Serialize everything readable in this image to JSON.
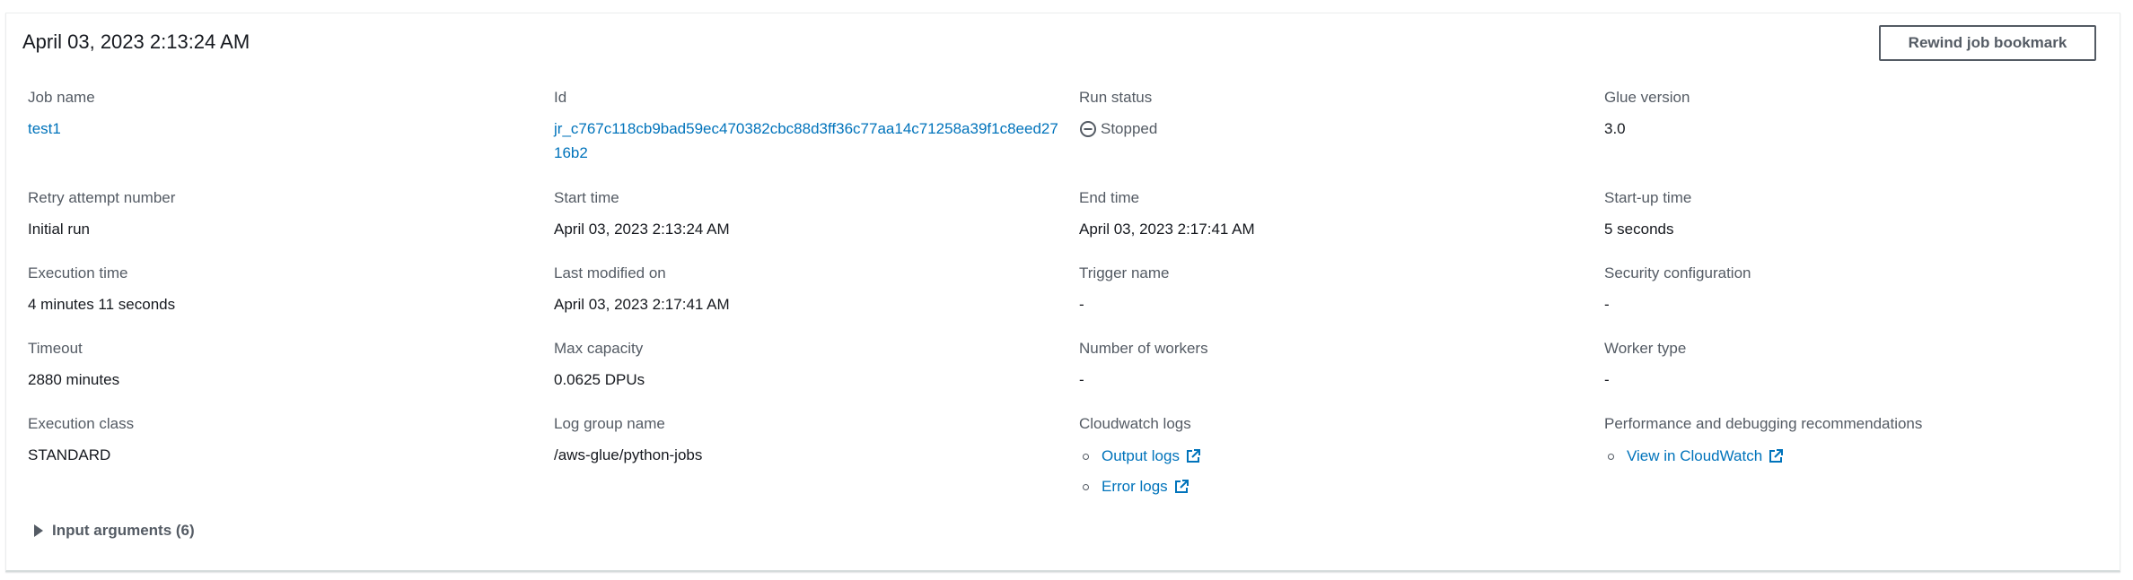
{
  "header": {
    "title": "April 03, 2023 2:13:24 AM",
    "rewind_button": "Rewind job bookmark"
  },
  "fields": {
    "job_name": {
      "label": "Job name",
      "value": "test1"
    },
    "id": {
      "label": "Id",
      "value": "jr_c767c118cb9bad59ec470382cbc88d3ff36c77aa14c71258a39f1c8eed2716b2"
    },
    "run_status": {
      "label": "Run status",
      "value": "Stopped",
      "icon": "stopped-status-icon"
    },
    "glue_version": {
      "label": "Glue version",
      "value": "3.0"
    },
    "retry_attempt": {
      "label": "Retry attempt number",
      "value": "Initial run"
    },
    "start_time": {
      "label": "Start time",
      "value": "April 03, 2023 2:13:24 AM"
    },
    "end_time": {
      "label": "End time",
      "value": "April 03, 2023 2:17:41 AM"
    },
    "startup_time": {
      "label": "Start-up time",
      "value": "5 seconds"
    },
    "execution_time": {
      "label": "Execution time",
      "value": "4 minutes 11 seconds"
    },
    "last_modified": {
      "label": "Last modified on",
      "value": "April 03, 2023 2:17:41 AM"
    },
    "trigger_name": {
      "label": "Trigger name",
      "value": "-"
    },
    "security_config": {
      "label": "Security configuration",
      "value": "-"
    },
    "timeout": {
      "label": "Timeout",
      "value": "2880 minutes"
    },
    "max_capacity": {
      "label": "Max capacity",
      "value": "0.0625 DPUs"
    },
    "num_workers": {
      "label": "Number of workers",
      "value": "-"
    },
    "worker_type": {
      "label": "Worker type",
      "value": "-"
    },
    "execution_class": {
      "label": "Execution class",
      "value": "STANDARD"
    },
    "log_group": {
      "label": "Log group name",
      "value": "/aws-glue/python-jobs"
    },
    "cloudwatch_logs": {
      "label": "Cloudwatch logs",
      "links": [
        {
          "label": "Output logs",
          "icon": "external-link-icon"
        },
        {
          "label": "Error logs",
          "icon": "external-link-icon"
        }
      ]
    },
    "perf_debug": {
      "label": "Performance and debugging recommendations",
      "links": [
        {
          "label": "View in CloudWatch",
          "icon": "external-link-icon"
        }
      ]
    }
  },
  "input_arguments": {
    "label": "Input arguments (6)",
    "expanded": false
  },
  "colors": {
    "link": "#0073bb",
    "label": "#545b64",
    "text": "#16191f"
  }
}
